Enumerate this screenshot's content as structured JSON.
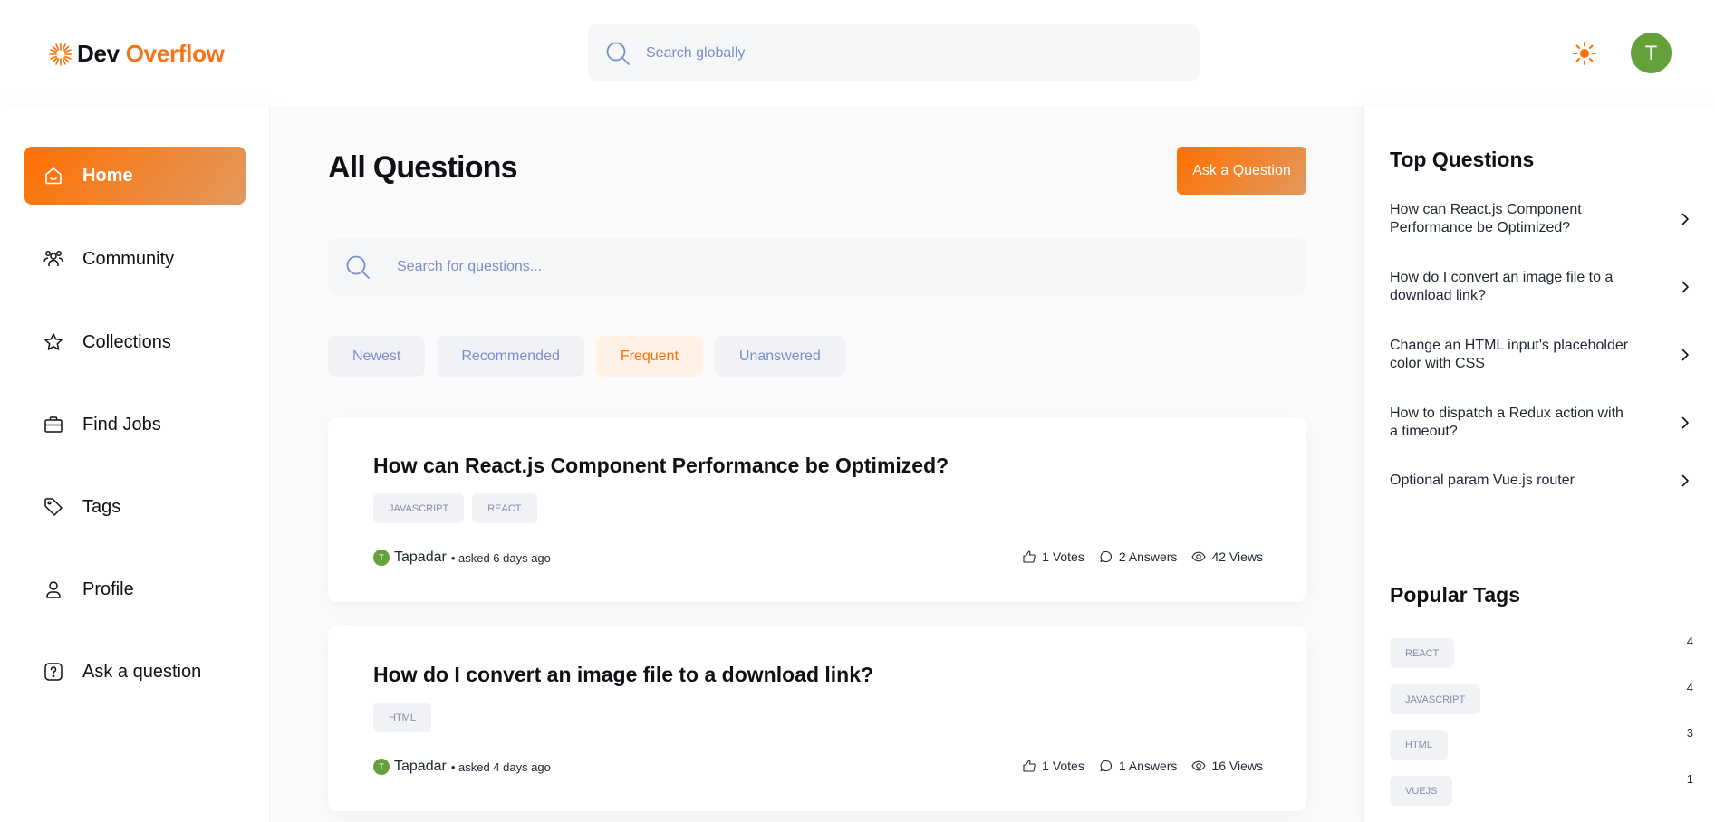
{
  "header": {
    "logo_part1": "Dev",
    "logo_part2": "Overflow",
    "search_placeholder": "Search globally",
    "avatar_initial": "T",
    "accent": "#ff7000"
  },
  "sidebar": {
    "items": [
      {
        "label": "Home",
        "icon": "home-icon",
        "active": true
      },
      {
        "label": "Community",
        "icon": "users-icon"
      },
      {
        "label": "Collections",
        "icon": "star-icon"
      },
      {
        "label": "Find Jobs",
        "icon": "briefcase-icon"
      },
      {
        "label": "Tags",
        "icon": "tag-icon"
      },
      {
        "label": "Profile",
        "icon": "user-icon"
      },
      {
        "label": "Ask a question",
        "icon": "question-icon"
      }
    ]
  },
  "main": {
    "title": "All Questions",
    "ask_button": "Ask a Question",
    "search_placeholder": "Search for questions...",
    "filters": [
      {
        "label": "Newest"
      },
      {
        "label": "Recommended"
      },
      {
        "label": "Frequent",
        "active": true
      },
      {
        "label": "Unanswered"
      }
    ],
    "questions": [
      {
        "title": "How can React.js Component Performance be Optimized?",
        "tags": [
          "JAVASCRIPT",
          "REACT"
        ],
        "author_initial": "T",
        "author": "Tapadar",
        "asked": "• asked 6 days ago",
        "votes": "1 Votes",
        "answers": "2 Answers",
        "views": "42 Views"
      },
      {
        "title": "How do I convert an image file to a download link?",
        "tags": [
          "HTML"
        ],
        "author_initial": "T",
        "author": "Tapadar",
        "asked": "• asked 4 days ago",
        "votes": "1 Votes",
        "answers": "1 Answers",
        "views": "16 Views"
      }
    ]
  },
  "rightbar": {
    "top_questions_title": "Top Questions",
    "top_questions": [
      "How can React.js Component Performance be Optimized?",
      "How do I convert an image file to a download link?",
      "Change an HTML input's placeholder color with CSS",
      "How to dispatch a Redux action with a timeout?",
      "Optional param Vue.js router"
    ],
    "popular_tags_title": "Popular Tags",
    "popular_tags": [
      {
        "name": "REACT",
        "count": "4"
      },
      {
        "name": "JAVASCRIPT",
        "count": "4"
      },
      {
        "name": "HTML",
        "count": "3"
      },
      {
        "name": "VUEJS",
        "count": "1"
      }
    ]
  }
}
